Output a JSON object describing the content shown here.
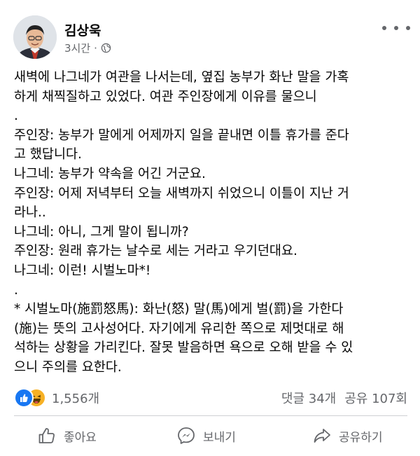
{
  "post": {
    "author": "김상욱",
    "time": "3시간",
    "separator": "·",
    "visibility_icon": "globe-icon",
    "more_icon": "more-icon",
    "lines": [
      "새벽에 나그네가 여관을 나서는데, 옆집 농부가 화난 말을 가혹",
      "하게 채찍질하고 있었다. 여관 주인장에게 이유를 물으니",
      ".",
      "주인장: 농부가 말에게 어제까지 일을 끝내면 이틀 휴가를 준다",
      "고 했답니다.",
      "나그네: 농부가 약속을 어긴 거군요.",
      "주인장: 어제 저녁부터 오늘 새벽까지 쉬었으니 이틀이 지난 거",
      "라나..",
      "나그네: 아니, 그게 말이 됩니까?",
      "주인장: 원래 휴가는 날수로 세는 거라고 우기던대요.",
      "나그네: 이런! 시벌노마*!",
      ".",
      "* 시벌노마(施罰怒馬): 화난(怒) 말(馬)에게 벌(罰)을 가한다",
      "(施)는 뜻의 고사성어다. 자기에게 유리한 쪽으로 제멋대로 해",
      "석하는 상황을 가리킨다. 잘못 발음하면 욕으로 오해 받을 수 있",
      "으니 주의를 요한다."
    ]
  },
  "reactions": {
    "count": "1,556개",
    "comments": "댓글 34개",
    "shares": "공유 107회",
    "types": [
      "like",
      "haha"
    ]
  },
  "actions": {
    "like_label": "좋아요",
    "send_label": "보내기",
    "share_label": "공유하기"
  },
  "colors": {
    "text": "#050505",
    "secondary": "#65676b",
    "like_blue": "#1877f2",
    "haha_yellow": "#f7b125",
    "divider": "#ced0d4"
  }
}
